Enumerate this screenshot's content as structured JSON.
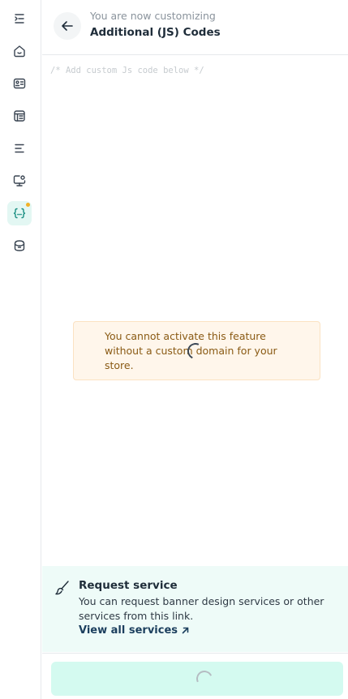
{
  "sidebar": {
    "items": [
      {
        "icon": "collapse-menu-icon"
      },
      {
        "icon": "home-icon"
      },
      {
        "icon": "id-card-icon"
      },
      {
        "icon": "storefront-icon"
      },
      {
        "icon": "list-icon"
      },
      {
        "icon": "monitor-settings-icon"
      },
      {
        "icon": "code-braces-icon",
        "active": true,
        "has_badge": true
      },
      {
        "icon": "package-icon"
      }
    ],
    "accent_color": "#1b8f82",
    "badge_color": "#f2b126"
  },
  "header": {
    "subtitle": "You are now customizing",
    "title": "Additional (JS) Codes"
  },
  "editor": {
    "placeholder": "/* Add custom Js code below */",
    "value": ""
  },
  "warning": {
    "text": "You cannot activate this feature without a custom domain for your store.",
    "background": "#fff6eb"
  },
  "service": {
    "title": "Request service",
    "description": "You can request banner design services or other services from this link.",
    "link_label": "View all services",
    "background": "#eefbf8"
  },
  "footer": {
    "save_button_state": "loading",
    "save_button_color": "#d4faf0"
  }
}
